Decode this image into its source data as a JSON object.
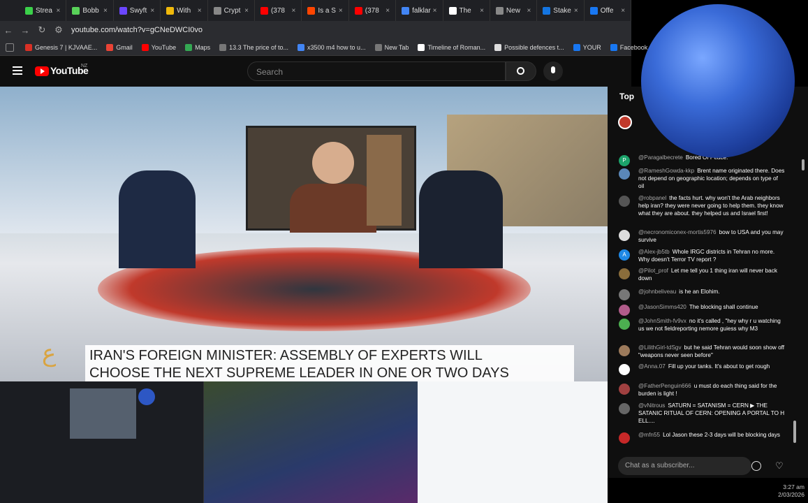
{
  "browser": {
    "tabs": [
      {
        "label": "Strea",
        "color": "#3bd14a"
      },
      {
        "label": "Bobb",
        "color": "#59d259"
      },
      {
        "label": "Swyft",
        "color": "#6b46ff"
      },
      {
        "label": "With",
        "color": "#f0b90b"
      },
      {
        "label": "Crypt",
        "color": "#888888"
      },
      {
        "label": "(378",
        "color": "#ff0000"
      },
      {
        "label": "Is a S",
        "color": "#ff4500"
      },
      {
        "label": "(378",
        "color": "#ff0000"
      },
      {
        "label": "falklar",
        "color": "#4285f4"
      },
      {
        "label": "The",
        "color": "#ffffff"
      },
      {
        "label": "New",
        "color": "#888888"
      },
      {
        "label": "Stake",
        "color": "#1475e1"
      },
      {
        "label": "Offe",
        "color": "#1877f2"
      }
    ],
    "url": "youtube.com/watch?v=gCNeDWCI0vo",
    "bookmarks": [
      {
        "label": "Genesis 7 | KJVAAE...",
        "color": "#d93025"
      },
      {
        "label": "Gmail",
        "color": "#ea4335"
      },
      {
        "label": "YouTube",
        "color": "#ff0000"
      },
      {
        "label": "Maps",
        "color": "#34a853"
      },
      {
        "label": "13.3 The price of to...",
        "color": "#777777"
      },
      {
        "label": "x3500 m4 how to u...",
        "color": "#4285f4"
      },
      {
        "label": "New Tab",
        "color": "#777777"
      },
      {
        "label": "Timeline of Roman...",
        "color": "#ffffff"
      },
      {
        "label": "Possible defences t...",
        "color": "#dddddd"
      },
      {
        "label": "YOUR",
        "color": "#1877f2"
      },
      {
        "label": "Facebook green",
        "color": "#1877f2"
      }
    ]
  },
  "youtube": {
    "logo_text": "YouTube",
    "region": "NZ",
    "search_placeholder": "Search",
    "banner_line1": "IRAN'S FOREIGN MINISTER: ASSEMBLY OF EXPERTS WILL",
    "banner_line2": "CHOOSE THE NEXT SUPREME LEADER IN ONE OR TWO DAYS",
    "chat_tab": "Top"
  },
  "chat": {
    "messages": [
      {
        "author": "@Paragalbecrete",
        "text": "Bored Of Peace.",
        "color": "#1ca36b",
        "initial": "P"
      },
      {
        "author": "@RameshGowda-kkp",
        "text": "Brent name originated there. Does not depend on geographic location; depends on type of oil",
        "color": "#5a87b8",
        "initial": ""
      },
      {
        "author": "@robpanel",
        "text": "the facts hurt. why won't the Arab neighbors help iran? they were never going to help them. they know what they are about. they helped us and Israel first!",
        "color": "#555555",
        "initial": ""
      },
      {
        "author": "@necronomiconex-mortis5976",
        "text": "bow to USA and you may survive",
        "color": "#dddddd",
        "initial": ""
      },
      {
        "author": "@Alex-jb5tb",
        "text": "Whole IRGC districts in Tehran no more. Why doesn't Terror TV report ?",
        "color": "#1e88e5",
        "initial": "A"
      },
      {
        "author": "@Pilot_prof",
        "text": "Let me tell you 1 thing iran will never back down",
        "color": "#8a6d3b",
        "initial": ""
      },
      {
        "author": "@johnbeliveau",
        "text": "is he an Elohim.",
        "color": "#777777",
        "initial": ""
      },
      {
        "author": "@JasonSimms420",
        "text": "The blocking shall continue",
        "color": "#b05c8a",
        "initial": ""
      },
      {
        "author": "@JohnSmith-fv9vx",
        "text": "no it's called , \"hey why r u watching us we not fieldreporting nemore guiess why M3",
        "color": "#4caf50",
        "initial": ""
      },
      {
        "author": "@LilithGirl-tdSgv",
        "text": "but he said Tehran would soon show off \"weapons never seen before\"",
        "color": "#9c7a5b",
        "initial": ""
      },
      {
        "author": "@Anna.07",
        "text": "Fill up your tanks. It's about to get rough",
        "color": "#ffffff",
        "initial": ""
      },
      {
        "author": "@FatherPenguin666",
        "text": "u must do each thing said for the burden is light !",
        "color": "#a04040",
        "initial": ""
      },
      {
        "author": "@vNitrous",
        "text": "SATURN = SATANISM = CERN ▶ THE SATANIC RITUAL OF CERN: OPENING A PORTAL TO H ELL....",
        "color": "#666666",
        "initial": ""
      },
      {
        "author": "@mfn55",
        "text": "Lol Jason these 2-3 days will be blocking days",
        "color": "#c62828",
        "initial": ""
      }
    ],
    "input_placeholder": "Chat as a subscriber..."
  },
  "taskbar": {
    "time": "3:27 am",
    "date": "2/03/2026"
  }
}
